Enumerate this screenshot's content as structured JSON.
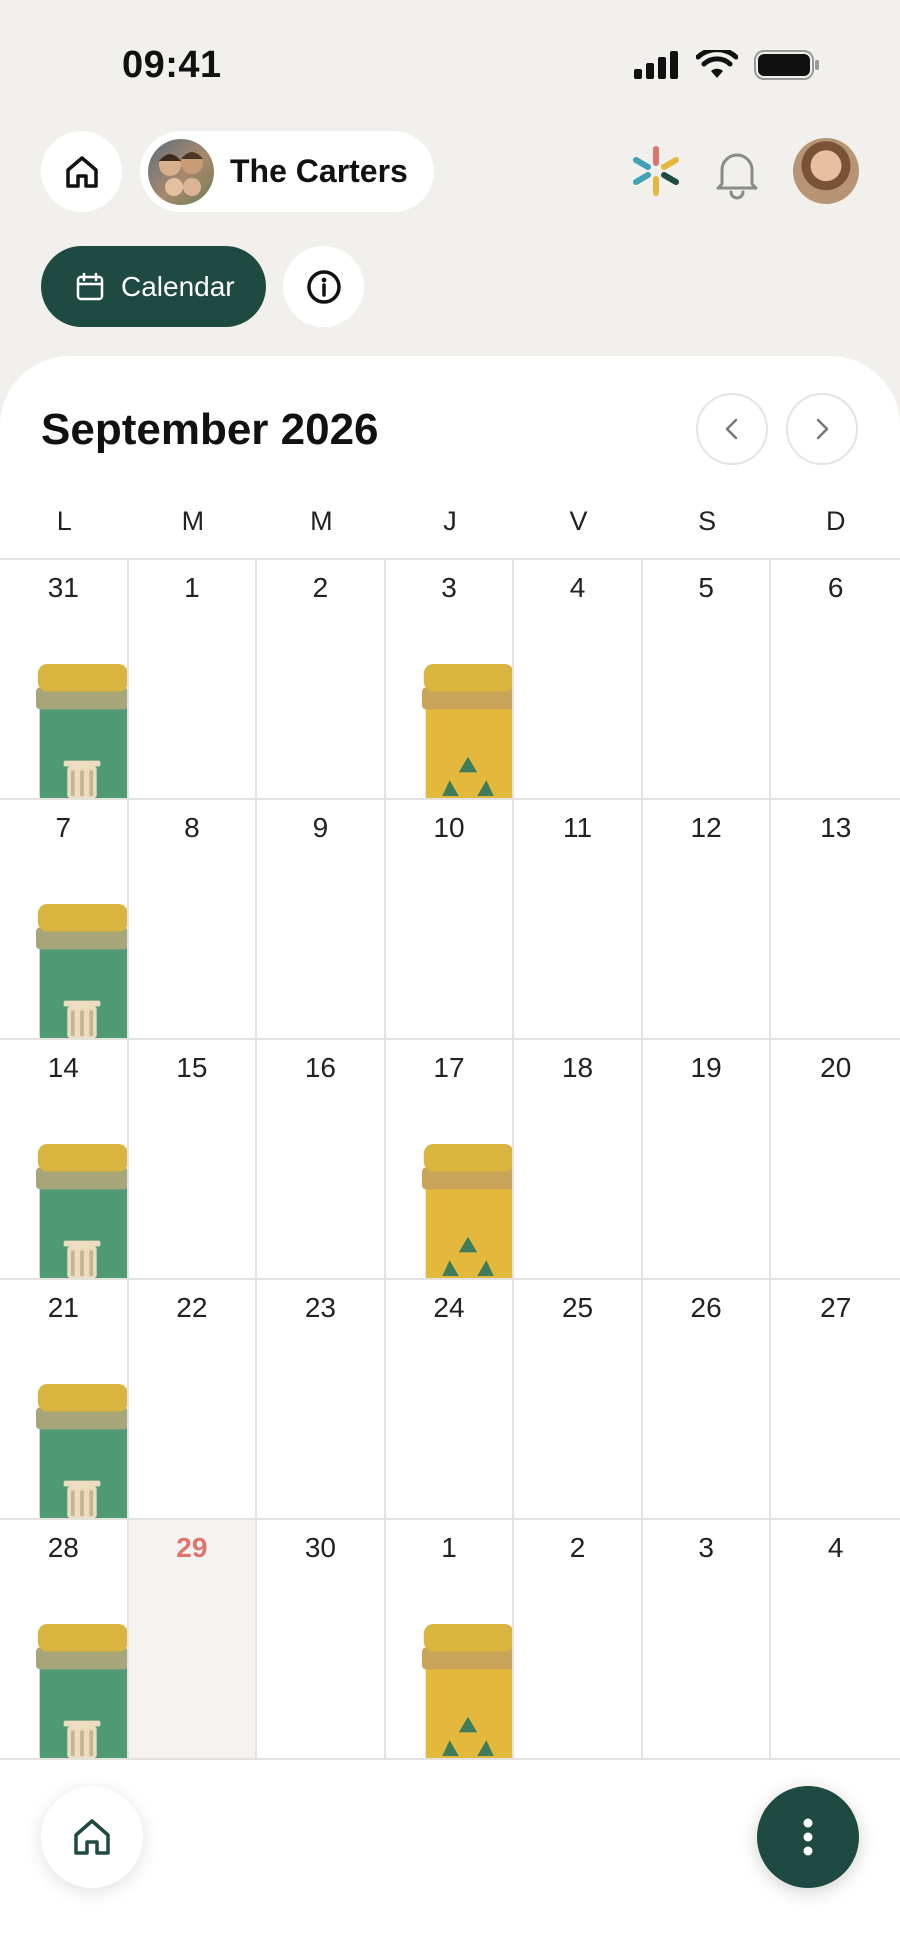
{
  "status_bar": {
    "time": "09:41"
  },
  "header": {
    "family_name": "The Carters",
    "calendar_label": "Calendar"
  },
  "calendar": {
    "month_title": "September 2026",
    "weekdays": [
      "L",
      "M",
      "M",
      "J",
      "V",
      "S",
      "D"
    ],
    "weeks": [
      [
        "31",
        "1",
        "2",
        "3",
        "4",
        "5",
        "6"
      ],
      [
        "7",
        "8",
        "9",
        "10",
        "11",
        "12",
        "13"
      ],
      [
        "14",
        "15",
        "16",
        "17",
        "18",
        "19",
        "20"
      ],
      [
        "21",
        "22",
        "23",
        "24",
        "25",
        "26",
        "27"
      ],
      [
        "28",
        "29",
        "30",
        "1",
        "2",
        "3",
        "4"
      ]
    ],
    "today": "29",
    "bins": [
      {
        "week": 0,
        "day": 0,
        "type": "general-waste-bin-icon"
      },
      {
        "week": 0,
        "day": 3,
        "type": "recycling-bin-icon"
      },
      {
        "week": 1,
        "day": 0,
        "type": "general-waste-bin-icon"
      },
      {
        "week": 2,
        "day": 0,
        "type": "general-waste-bin-icon"
      },
      {
        "week": 2,
        "day": 3,
        "type": "recycling-bin-icon"
      },
      {
        "week": 3,
        "day": 0,
        "type": "general-waste-bin-icon"
      },
      {
        "week": 4,
        "day": 0,
        "type": "general-waste-bin-icon"
      },
      {
        "week": 4,
        "day": 3,
        "type": "recycling-bin-icon"
      }
    ]
  },
  "colors": {
    "accent": "#1f4a42",
    "today": "#e0736b",
    "background": "#f1f0ed",
    "green_bin": "#4f9a74",
    "yellow_bin": "#e4b83c"
  }
}
